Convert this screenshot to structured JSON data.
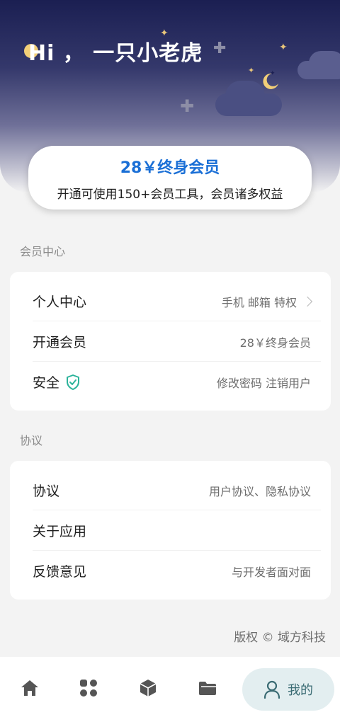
{
  "header": {
    "greeting": "Hi ，  一只小老虎"
  },
  "member_card": {
    "title": "28￥终身会员",
    "subtitle": "开通可使用150+会员工具，会员诸多权益"
  },
  "sections": {
    "member_center": {
      "title": "会员中心",
      "rows": [
        {
          "label": "个人中心",
          "value": "手机 邮箱 特权"
        },
        {
          "label": "开通会员",
          "value": "28￥终身会员"
        },
        {
          "label": "安全",
          "value": "修改密码  注销用户"
        }
      ]
    },
    "agreement": {
      "title": "协议",
      "rows": [
        {
          "label": "协议",
          "value": "用户协议、隐私协议"
        },
        {
          "label": "关于应用",
          "value": ""
        },
        {
          "label": "反馈意见",
          "value": "与开发者面对面"
        }
      ]
    }
  },
  "footer": {
    "copyright": "版权 © 域方科技"
  },
  "tabbar": {
    "active_label": "我的",
    "icons": [
      "home-icon",
      "apps-grid-icon",
      "cube-icon",
      "folder-icon",
      "user-icon"
    ]
  },
  "colors": {
    "accent": "#1a6fd6",
    "shield": "#2bb39a",
    "tab_active_bg": "#e3eef0",
    "tab_active_fg": "#3a6b73"
  }
}
